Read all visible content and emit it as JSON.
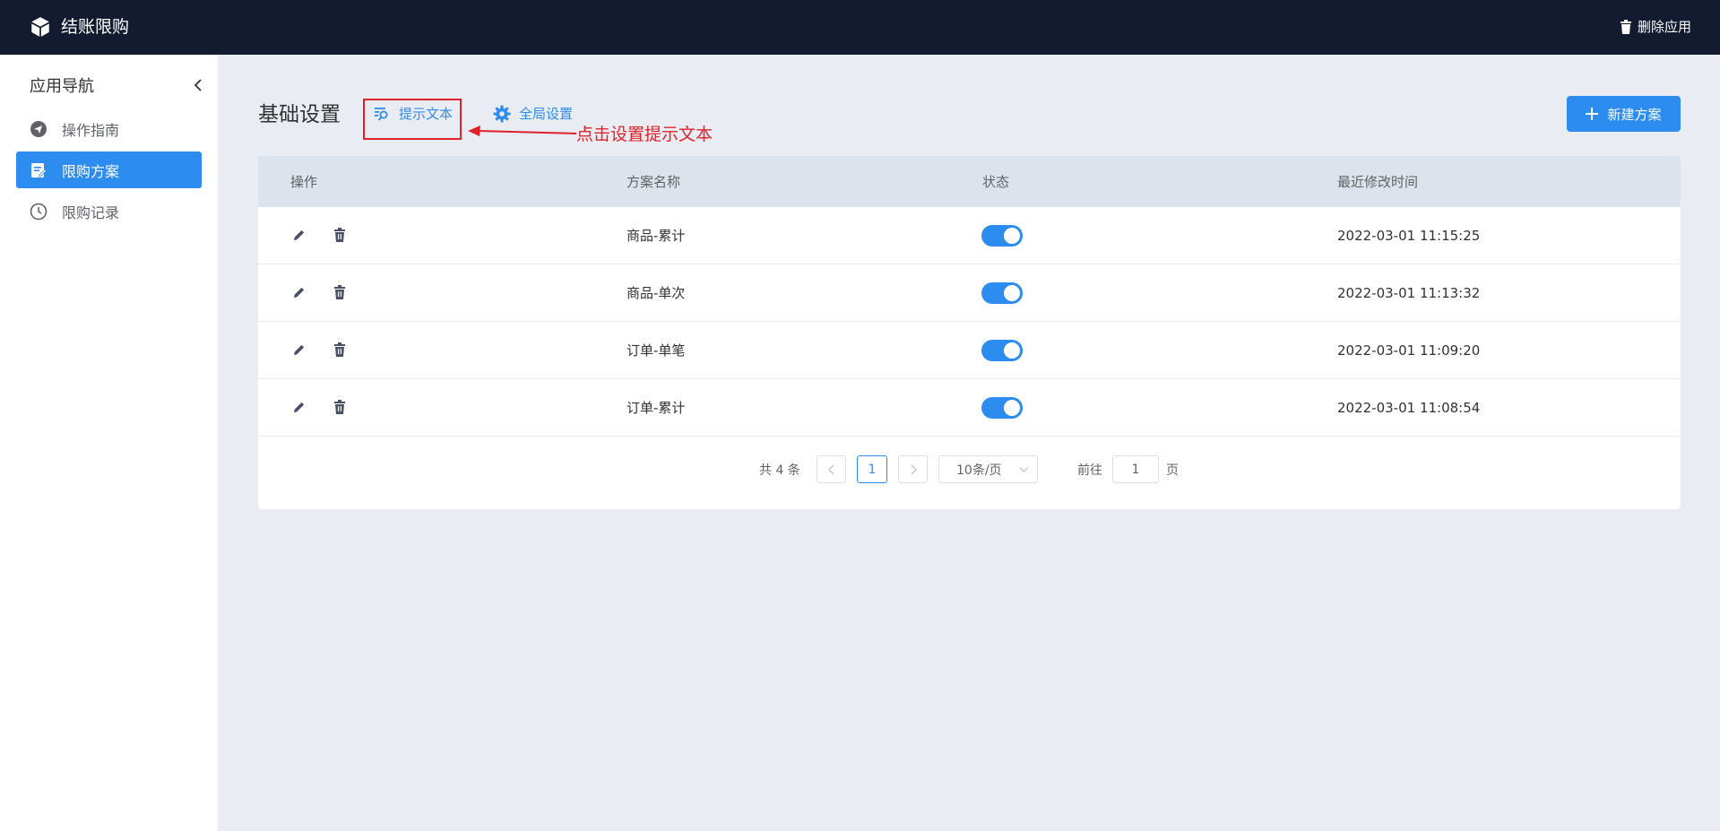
{
  "header": {
    "app_title": "结账限购",
    "delete_label": "删除应用"
  },
  "sidebar": {
    "title": "应用导航",
    "items": [
      {
        "label": "操作指南",
        "icon": "send-icon",
        "active": false
      },
      {
        "label": "限购方案",
        "icon": "document-edit-icon",
        "active": true
      },
      {
        "label": "限购记录",
        "icon": "clock-icon",
        "active": false
      }
    ]
  },
  "main": {
    "page_title": "基础设置",
    "tabs": [
      {
        "label": "提示文本",
        "icon": "text-search-icon"
      },
      {
        "label": "全局设置",
        "icon": "gear-icon"
      }
    ],
    "annotation": "点击设置提示文本",
    "new_button_label": "新建方案"
  },
  "table": {
    "columns": [
      "操作",
      "方案名称",
      "状态",
      "最近修改时间"
    ],
    "rows": [
      {
        "name": "商品-累计",
        "enabled": true,
        "modified": "2022-03-01 11:15:25"
      },
      {
        "name": "商品-单次",
        "enabled": true,
        "modified": "2022-03-01 11:13:32"
      },
      {
        "name": "订单-单笔",
        "enabled": true,
        "modified": "2022-03-01 11:09:20"
      },
      {
        "name": "订单-累计",
        "enabled": true,
        "modified": "2022-03-01 11:08:54"
      }
    ]
  },
  "pagination": {
    "total_text": "共 4 条",
    "current_page": "1",
    "page_size": "10条/页",
    "goto_label": "前往",
    "goto_value": "1",
    "page_suffix": "页"
  },
  "colors": {
    "topbar": "#131b30",
    "accent": "#2d8cf0",
    "annotation": "#e0222b"
  }
}
